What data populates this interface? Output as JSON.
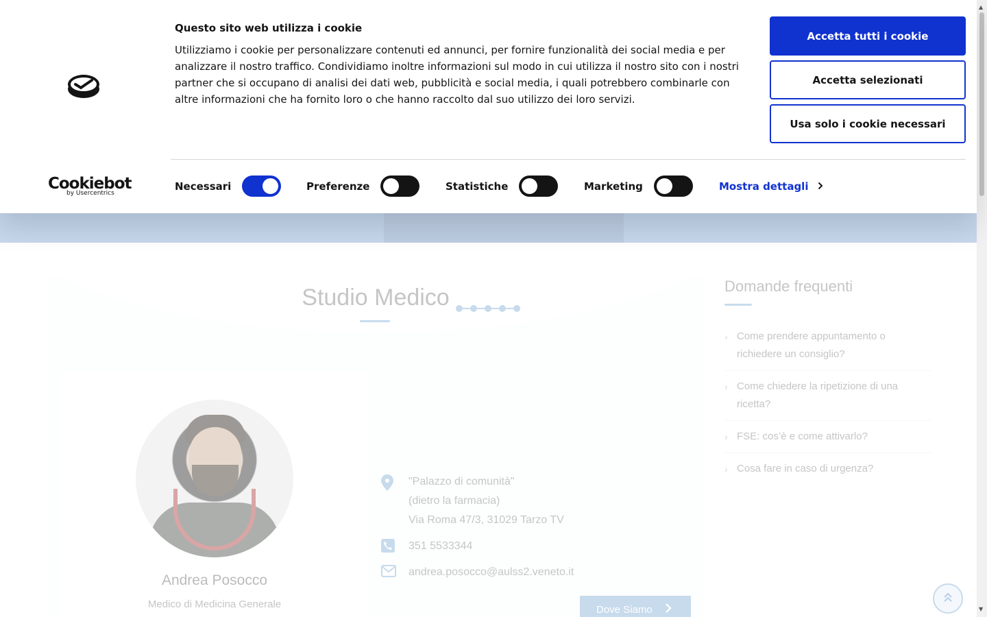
{
  "cookie_banner": {
    "title": "Questo sito web utilizza i cookie",
    "text": "Utilizziamo i cookie per personalizzare contenuti ed annunci, per fornire funzionalità dei social media e per analizzare il nostro traffico. Condividiamo inoltre informazioni sul modo in cui utilizza il nostro sito con i nostri partner che si occupano di analisi dei dati web, pubblicità e social media, i quali potrebbero combinarle con altre informazioni che ha fornito loro o che hanno raccolto dal suo utilizzo dei loro servizi.",
    "brand_name": "Cookiebot",
    "brand_by": "by Usercentrics",
    "buttons": {
      "accept_all": "Accetta tutti i cookie",
      "accept_selected": "Accetta selezionati",
      "necessary_only": "Usa solo i cookie necessari"
    },
    "toggles": [
      {
        "label": "Necessari",
        "on": true
      },
      {
        "label": "Preferenze",
        "on": false
      },
      {
        "label": "Statistiche",
        "on": false
      },
      {
        "label": "Marketing",
        "on": false
      }
    ],
    "show_details": "Mostra dettagli",
    "accent_color": "#1032cf"
  },
  "main": {
    "section_title": "Studio Medico",
    "doctor": {
      "name": "Andrea Posocco",
      "role": "Medico di Medicina Generale"
    },
    "address_lines": [
      "\"Palazzo di comunità\"",
      "(dietro la farmacia)",
      "Via Roma 47/3, 31029 Tarzo TV"
    ],
    "phone": "351 5533344",
    "email": "andrea.posocco@aulss2.veneto.it",
    "map_button": "Dove Siamo",
    "accent_color": "#8fb6d9"
  },
  "faq": {
    "title": "Domande frequenti",
    "items": [
      "Come prendere appuntamento o richiedere un consiglio?",
      "Come chiedere la ripetizione di una ricetta?",
      "FSE: cos’è e come attivarlo?",
      "Cosa fare in caso di urgenza?"
    ]
  },
  "icons": {
    "location": "map-pin-icon",
    "phone": "phone-icon",
    "email": "envelope-icon",
    "back_to_top": "double-chevron-up-icon"
  }
}
